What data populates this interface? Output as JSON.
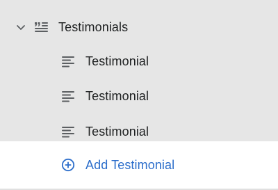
{
  "group": {
    "label": "Testimonials",
    "expanded": true,
    "chevron_icon": "chevron-down-icon",
    "icon": "testimonials-section-icon"
  },
  "items": [
    {
      "label": "Testimonial",
      "icon": "text-block-icon"
    },
    {
      "label": "Testimonial",
      "icon": "text-block-icon"
    },
    {
      "label": "Testimonial",
      "icon": "text-block-icon"
    }
  ],
  "add_button": {
    "label": "Add Testimonial",
    "icon": "circle-plus-icon"
  },
  "colors": {
    "panel_background": "#e6e6e6",
    "add_row_background": "#ffffff",
    "text": "#202223",
    "icon": "#5c5f62",
    "accent": "#2c6ecb"
  }
}
